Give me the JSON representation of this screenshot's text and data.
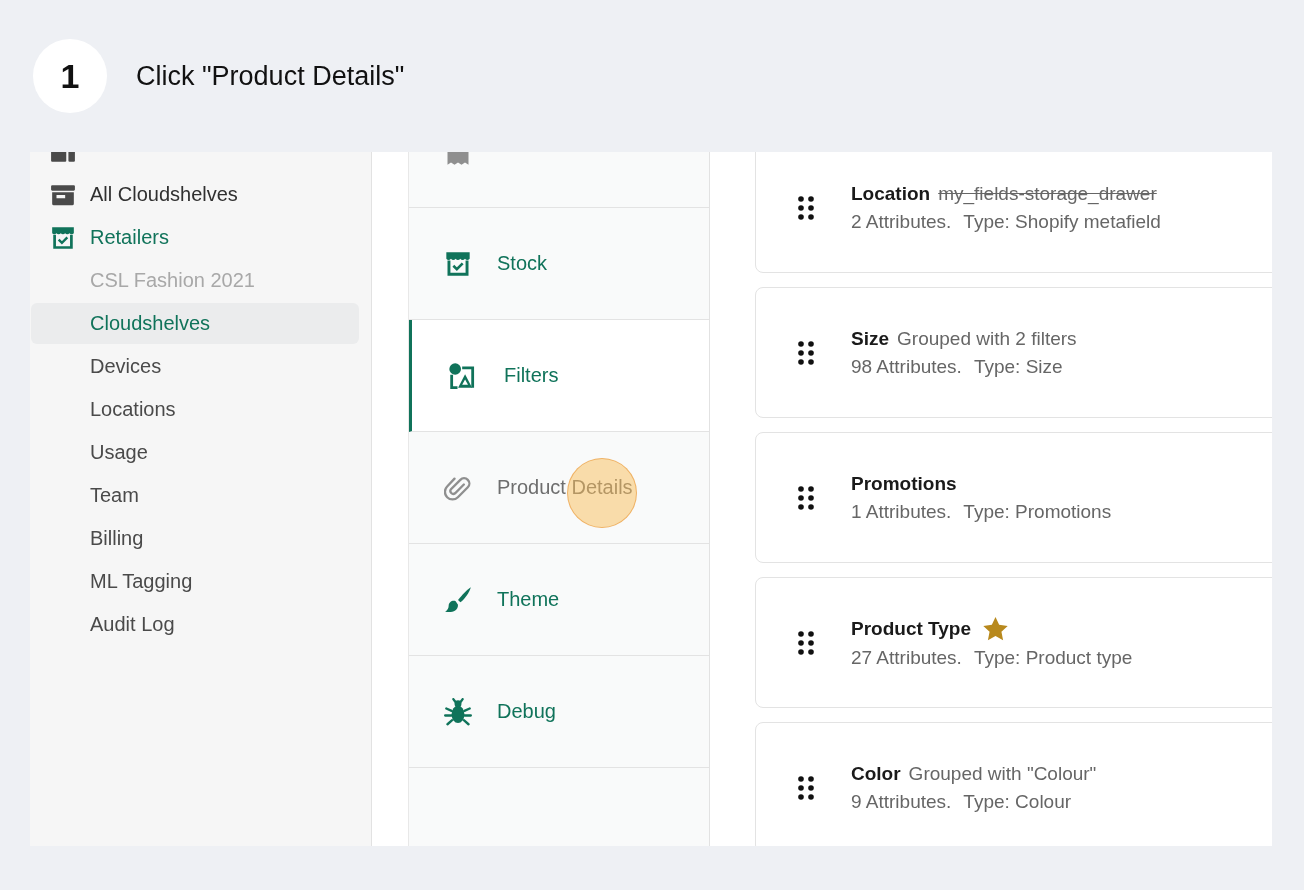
{
  "step": {
    "number": "1",
    "instruction": "Click \"Product Details\""
  },
  "sidebar": {
    "items": [
      {
        "selected": false
      },
      {
        "label": "All Cloudshelves",
        "selected": false
      },
      {
        "label": "Retailers",
        "selected": true,
        "children": [
          {
            "label": "CSL Fashion 2021",
            "selected": false,
            "disabled": true
          },
          {
            "label": "Cloudshelves",
            "selected": true,
            "disabled": false
          },
          {
            "label": "Devices",
            "selected": false,
            "disabled": false
          },
          {
            "label": "Locations",
            "selected": false,
            "disabled": false
          },
          {
            "label": "Usage",
            "selected": false,
            "disabled": false
          },
          {
            "label": "Team",
            "selected": false,
            "disabled": false
          },
          {
            "label": "Billing",
            "selected": false,
            "disabled": false
          },
          {
            "label": "ML Tagging",
            "selected": false,
            "disabled": false
          },
          {
            "label": "Audit Log",
            "selected": false,
            "disabled": false
          }
        ]
      }
    ]
  },
  "tabs": [
    {
      "selected": false,
      "disabled": true
    },
    {
      "label": "Stock",
      "selected": false,
      "disabled": false
    },
    {
      "label": "Filters",
      "selected": true,
      "disabled": false
    },
    {
      "label": "Product Details",
      "selected": false,
      "disabled": true
    },
    {
      "label": "Theme",
      "selected": false,
      "disabled": false
    },
    {
      "label": "Debug",
      "selected": false,
      "disabled": false
    }
  ],
  "filters": [
    {
      "name": "Location",
      "note": {
        "text": "my_fields-storage_drawer",
        "struck": true
      },
      "attributes": "2 Attributes.",
      "type": "Type: Shopify metafield",
      "starred": false
    },
    {
      "name": "Size",
      "note": {
        "text": "Grouped with 2 filters",
        "struck": false
      },
      "attributes": "98 Attributes.",
      "type": "Type: Size",
      "starred": false
    },
    {
      "name": "Promotions",
      "attributes": "1 Attributes.",
      "type": "Type: Promotions",
      "starred": false
    },
    {
      "name": "Product Type",
      "attributes": "27 Attributes.",
      "type": "Type: Product type",
      "starred": true
    },
    {
      "name": "Color",
      "note": {
        "text": "Grouped with \"Colour\"",
        "struck": false
      },
      "attributes": "9 Attributes.",
      "type": "Type: Colour",
      "starred": false
    }
  ]
}
